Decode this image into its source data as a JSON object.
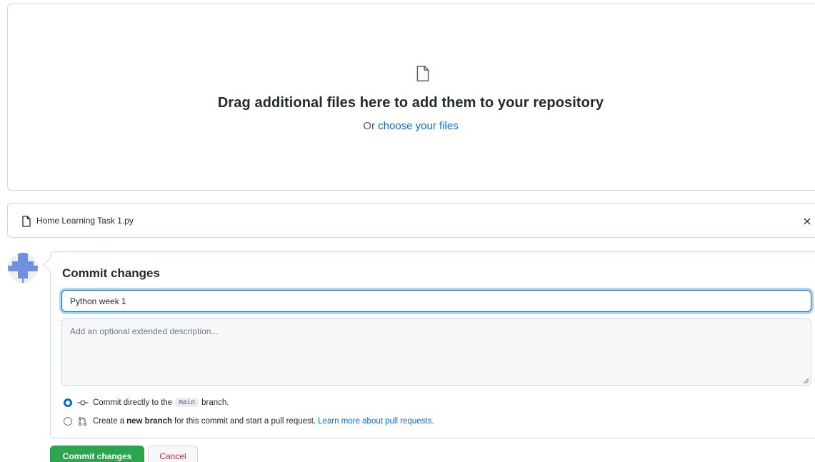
{
  "dropzone": {
    "icon": "file-icon",
    "title": "Drag additional files here to add them to your repository",
    "sub_prefix": "Or ",
    "sub_link": "choose your files"
  },
  "file": {
    "icon": "file-icon",
    "name": "Home Learning Task 1.py",
    "remove_label": "×"
  },
  "commit": {
    "title": "Commit changes",
    "summary_value": "Python week 1",
    "description_placeholder": "Add an optional extended description...",
    "option_direct": {
      "icon": "git-commit-icon",
      "text_before": "Commit directly to the",
      "branch": "main",
      "text_after": "branch.",
      "selected": true
    },
    "option_new_branch": {
      "icon": "git-pull-request-icon",
      "text_before": "Create a",
      "strong": "new branch",
      "text_after": "for this commit and start a pull request.",
      "link": "Learn more about pull requests.",
      "selected": false
    }
  },
  "buttons": {
    "commit_label": "Commit changes",
    "cancel_label": "Cancel"
  },
  "colors": {
    "accent": "#0969da",
    "commit_green": "#2da44e",
    "danger": "#cf222e",
    "avatar": "#6f8fe0"
  }
}
